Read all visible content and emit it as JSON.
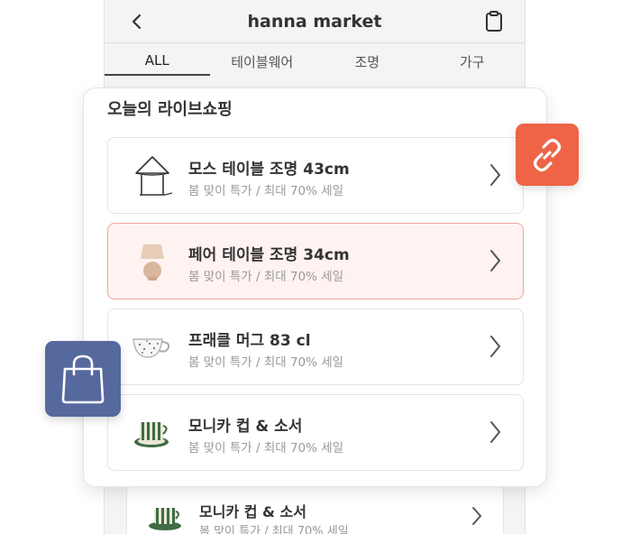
{
  "app": {
    "title": "hanna market"
  },
  "icons": {
    "back": "chevron-left-icon",
    "clipboard": "clipboard-icon",
    "link": "link-icon",
    "bag": "shopping-bag-icon",
    "chevron": "chevron-right-icon"
  },
  "tabs": [
    {
      "label": "ALL",
      "active": true
    },
    {
      "label": "테이블웨어",
      "active": false
    },
    {
      "label": "조명",
      "active": false
    },
    {
      "label": "가구",
      "active": false
    }
  ],
  "live": {
    "title": "오늘의 라이브쇼핑",
    "items": [
      {
        "name": "모스 테이블 조명 43cm",
        "sub": "봄 맞이 특가 / 최대 70% 세일",
        "icon": "lamp-icon"
      },
      {
        "name": "페어 테이블 조명 34cm",
        "sub": "봄 맞이 특가 / 최대 70% 세일",
        "icon": "ceramic-lamp-icon"
      },
      {
        "name": "프래클 머그 83 cl",
        "sub": "봄 맞이 특가 / 최대 70% 세일",
        "icon": "mug-icon"
      },
      {
        "name": "모니카 컵 & 소서",
        "sub": "봄 맞이 특가 / 최대 70% 세일",
        "icon": "cup-saucer-icon"
      }
    ]
  },
  "back_item": {
    "name": "모니카 컵 & 소서",
    "sub": "봄 맞이 특가 / 최대 70% 세일"
  },
  "colors": {
    "link_badge": "#ef6446",
    "bag_badge": "#56699e",
    "highlight_bg": "#fff3f1",
    "highlight_border": "#f0a79b"
  }
}
